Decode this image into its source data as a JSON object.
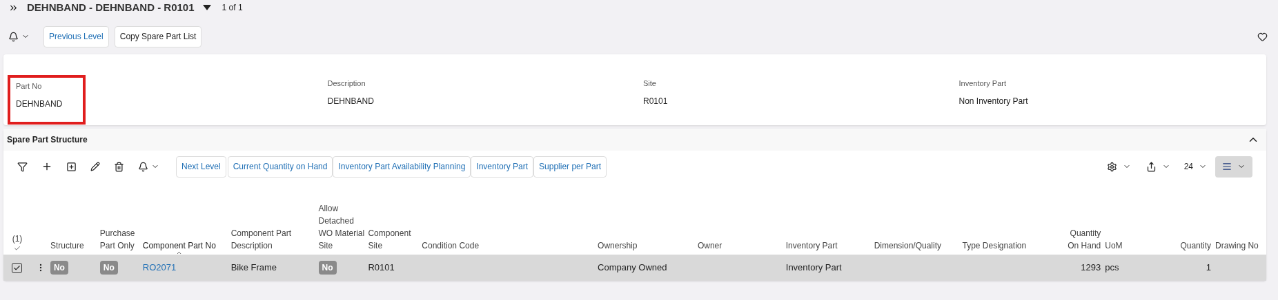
{
  "header": {
    "title": "DEHNBAND - DEHNBAND - R0101",
    "record_count": "1 of 1"
  },
  "page_toolbar": {
    "buttons": [
      {
        "label": "Previous Level",
        "kind": "link"
      },
      {
        "label": "Copy Spare Part List",
        "kind": "plain"
      }
    ]
  },
  "part_card": {
    "fields": [
      {
        "label": "Part No",
        "value": "DEHNBAND",
        "highlighted": true
      },
      {
        "label": "Description",
        "value": "DEHNBAND",
        "highlighted": false
      },
      {
        "label": "Site",
        "value": "R0101",
        "highlighted": false
      },
      {
        "label": "Inventory Part",
        "value": "Non Inventory Part",
        "highlighted": false
      }
    ]
  },
  "section": {
    "title": "Spare Part Structure",
    "expanded": true,
    "commands": [
      {
        "label": "Next Level"
      },
      {
        "label": "Current Quantity on Hand"
      },
      {
        "label": "Inventory Part Availability Planning"
      },
      {
        "label": "Inventory Part"
      },
      {
        "label": "Supplier per Part"
      }
    ],
    "page_size": "24",
    "table": {
      "selection_count": "(1)",
      "columns": [
        {
          "label": "Structure",
          "kind": "text",
          "sorted": false
        },
        {
          "label": "Purchase Part Only",
          "kind": "text",
          "sorted": false
        },
        {
          "label": "Component Part No",
          "kind": "text",
          "sorted": true
        },
        {
          "label": "Component Part Description",
          "kind": "text",
          "sorted": false
        },
        {
          "label": "Allow Detached WO Material Site",
          "kind": "text",
          "sorted": false
        },
        {
          "label": "Component Site",
          "kind": "text",
          "sorted": false
        },
        {
          "label": "Condition Code",
          "kind": "text",
          "sorted": false
        },
        {
          "label": "Ownership",
          "kind": "text",
          "sorted": false
        },
        {
          "label": "Owner",
          "kind": "text",
          "sorted": false
        },
        {
          "label": "Inventory Part",
          "kind": "text",
          "sorted": false
        },
        {
          "label": "Dimension/Quality",
          "kind": "text",
          "sorted": false
        },
        {
          "label": "Type Designation",
          "kind": "text",
          "sorted": false
        },
        {
          "label": "Quantity On Hand",
          "kind": "number",
          "sorted": false
        },
        {
          "label": "UoM",
          "kind": "text",
          "sorted": false
        },
        {
          "label": "Quantity",
          "kind": "number",
          "sorted": false
        },
        {
          "label": "Drawing No",
          "kind": "text",
          "sorted": false
        }
      ],
      "rows": [
        {
          "selected": true,
          "cells": [
            {
              "kind": "badge",
              "text": "No"
            },
            {
              "kind": "badge",
              "text": "No"
            },
            {
              "kind": "link",
              "text": "RO2071"
            },
            {
              "kind": "text",
              "text": "Bike Frame"
            },
            {
              "kind": "badge",
              "text": "No"
            },
            {
              "kind": "text",
              "text": "R0101"
            },
            {
              "kind": "empty"
            },
            {
              "kind": "text",
              "text": "Company Owned"
            },
            {
              "kind": "empty"
            },
            {
              "kind": "text",
              "text": "Inventory Part"
            },
            {
              "kind": "empty"
            },
            {
              "kind": "empty"
            },
            {
              "kind": "text",
              "text": "1293"
            },
            {
              "kind": "text",
              "text": "pcs"
            },
            {
              "kind": "text",
              "text": "1"
            },
            {
              "kind": "empty"
            }
          ]
        }
      ]
    }
  }
}
